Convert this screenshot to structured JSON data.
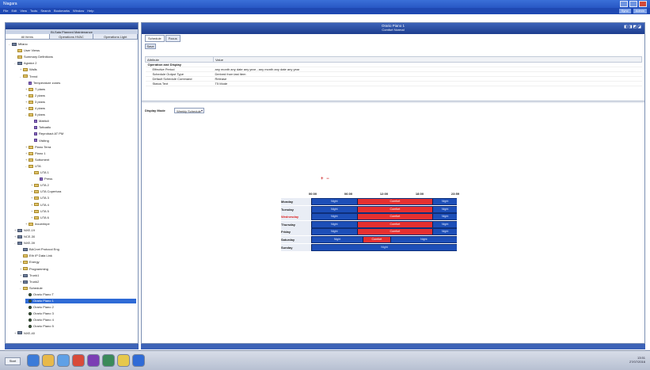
{
  "window": {
    "title": "Niagara",
    "menu": [
      "File",
      "Edit",
      "View",
      "Tools",
      "Search",
      "Bookmarks",
      "Window",
      "Help"
    ],
    "right_buttons": [
      "Sync",
      "Admin"
    ]
  },
  "left_pane": {
    "header": "Bi-Sala Planned Maintenance",
    "tabs": [
      "All Items",
      "Operations HVAC",
      "Operations Light"
    ],
    "tree": [
      {
        "label": "Milano",
        "depth": 0,
        "icon": "station-icon",
        "exp": "-"
      },
      {
        "label": "User Views",
        "depth": 1,
        "icon": "folder-icon",
        "exp": ""
      },
      {
        "label": "Summary Definitions",
        "depth": 1,
        "icon": "folder-icon",
        "exp": ""
      },
      {
        "label": "Agrator 2",
        "depth": 1,
        "icon": "controller-icon",
        "exp": "-"
      },
      {
        "label": "Walls",
        "depth": 2,
        "icon": "folder-icon",
        "exp": "+"
      },
      {
        "label": "Trend",
        "depth": 2,
        "icon": "folder-icon",
        "exp": "-"
      },
      {
        "label": "Temperature zones",
        "depth": 3,
        "icon": "point-icon",
        "exp": ""
      },
      {
        "label": "T plans",
        "depth": 3,
        "icon": "folder-icon",
        "exp": "+"
      },
      {
        "label": "2 plans",
        "depth": 3,
        "icon": "folder-icon",
        "exp": "+"
      },
      {
        "label": "3 plans",
        "depth": 3,
        "icon": "folder-icon",
        "exp": "+"
      },
      {
        "label": "4 plans",
        "depth": 3,
        "icon": "folder-icon",
        "exp": "+"
      },
      {
        "label": "5 plans",
        "depth": 3,
        "icon": "folder-icon",
        "exp": "-"
      },
      {
        "label": "Mattioli",
        "depth": 4,
        "icon": "point-icon",
        "exp": ""
      },
      {
        "label": "Tottoatlo",
        "depth": 4,
        "icon": "point-icon",
        "exp": ""
      },
      {
        "label": "Reprobact AT PM",
        "depth": 4,
        "icon": "point-icon",
        "exp": ""
      },
      {
        "label": "Visiting",
        "depth": 4,
        "icon": "point-icon",
        "exp": ""
      },
      {
        "label": "Piano Terra",
        "depth": 3,
        "icon": "folder-icon",
        "exp": "+"
      },
      {
        "label": "Piano 1",
        "depth": 3,
        "icon": "folder-icon",
        "exp": "+"
      },
      {
        "label": "Sottoment",
        "depth": 3,
        "icon": "folder-icon",
        "exp": "+"
      },
      {
        "label": "UTA",
        "depth": 3,
        "icon": "folder-icon",
        "exp": "-"
      },
      {
        "label": "UTA 1",
        "depth": 4,
        "icon": "folder-icon",
        "exp": "-"
      },
      {
        "label": "Press",
        "depth": 5,
        "icon": "point-icon",
        "exp": ""
      },
      {
        "label": "UTA 2",
        "depth": 4,
        "icon": "folder-icon",
        "exp": "+"
      },
      {
        "label": "UTA Copertura",
        "depth": 4,
        "icon": "folder-icon",
        "exp": "+"
      },
      {
        "label": "UTA 3",
        "depth": 4,
        "icon": "folder-icon",
        "exp": "+"
      },
      {
        "label": "UTA 4",
        "depth": 4,
        "icon": "folder-icon",
        "exp": "+"
      },
      {
        "label": "UTA 5",
        "depth": 4,
        "icon": "folder-icon",
        "exp": "+"
      },
      {
        "label": "UTA 6",
        "depth": 4,
        "icon": "folder-icon",
        "exp": "+"
      },
      {
        "label": "Incubrinpe",
        "depth": 3,
        "icon": "folder-icon",
        "exp": "+"
      },
      {
        "label": "NXE-19",
        "depth": 1,
        "icon": "network-icon",
        "exp": "+"
      },
      {
        "label": "NCE-30",
        "depth": 1,
        "icon": "network-icon",
        "exp": "+"
      },
      {
        "label": "NXE-39",
        "depth": 1,
        "icon": "network-icon",
        "exp": "-"
      },
      {
        "label": "BACnet Protocol Eng",
        "depth": 2,
        "icon": "network-icon",
        "exp": ""
      },
      {
        "label": "Eth IP Data Link",
        "depth": 2,
        "icon": "folder-icon",
        "exp": ""
      },
      {
        "label": "Energy",
        "depth": 2,
        "icon": "folder-icon",
        "exp": "+"
      },
      {
        "label": "Programming",
        "depth": 2,
        "icon": "folder-icon",
        "exp": "+"
      },
      {
        "label": "Trunk1",
        "depth": 2,
        "icon": "network-icon",
        "exp": "+"
      },
      {
        "label": "Trunk2",
        "depth": 2,
        "icon": "network-icon",
        "exp": "+"
      },
      {
        "label": "Schedule",
        "depth": 2,
        "icon": "folder-icon",
        "exp": "-"
      },
      {
        "label": "Orario Piano T",
        "depth": 3,
        "icon": "schedule-icon",
        "exp": ""
      },
      {
        "label": "Orario Piano 1",
        "depth": 3,
        "icon": "schedule-icon",
        "exp": "",
        "selected": true
      },
      {
        "label": "Orario Piano 2",
        "depth": 3,
        "icon": "schedule-icon",
        "exp": ""
      },
      {
        "label": "Orario Piano 3",
        "depth": 3,
        "icon": "schedule-icon",
        "exp": ""
      },
      {
        "label": "Orario Piano 4",
        "depth": 3,
        "icon": "schedule-icon",
        "exp": ""
      },
      {
        "label": "Orario Piano 5",
        "depth": 3,
        "icon": "schedule-icon",
        "exp": ""
      },
      {
        "label": "NXE-40",
        "depth": 1,
        "icon": "network-icon",
        "exp": "+"
      }
    ]
  },
  "right_pane": {
    "title": "Orario Piano 1",
    "subtitle": "Comfort   Normal",
    "tabs": [
      "Schedule",
      "Focus"
    ],
    "save_label": "Save",
    "table_headers": [
      "Attribute",
      "Value"
    ],
    "table_rows": [
      {
        "attr": "Operation and Display",
        "value": "",
        "group": true
      },
      {
        "attr": "Effective Period",
        "value": "any month any date any year - any month any date any year",
        "group": false
      },
      {
        "attr": "Schedule Output Type",
        "value": "Derived from last item",
        "group": false
      },
      {
        "attr": "Default Schedule Command",
        "value": "Release",
        "group": false
      },
      {
        "attr": "Status Text",
        "value": "T5 Mode",
        "group": false
      }
    ],
    "display_mode_label": "Display Mode",
    "display_mode_value": "Weekly Schedule"
  },
  "schedule": {
    "zoom_controls": "+ −",
    "ticks": [
      "00:00",
      "06:00",
      "12:00",
      "18:00",
      "23:59"
    ],
    "days": [
      {
        "name": "Monday",
        "today": false,
        "segments": [
          {
            "start": 0,
            "end": 7.5,
            "state": "Night"
          },
          {
            "start": 7.5,
            "end": 20,
            "state": "Comfort"
          },
          {
            "start": 20,
            "end": 24,
            "state": "Night"
          }
        ]
      },
      {
        "name": "Tuesday",
        "today": false,
        "segments": [
          {
            "start": 0,
            "end": 7.5,
            "state": "Night"
          },
          {
            "start": 7.5,
            "end": 20,
            "state": "Comfort"
          },
          {
            "start": 20,
            "end": 24,
            "state": "Night"
          }
        ]
      },
      {
        "name": "Wednesday",
        "today": true,
        "segments": [
          {
            "start": 0,
            "end": 7.5,
            "state": "Night"
          },
          {
            "start": 7.5,
            "end": 20,
            "state": "Comfort"
          },
          {
            "start": 20,
            "end": 24,
            "state": "Night"
          }
        ]
      },
      {
        "name": "Thursday",
        "today": false,
        "segments": [
          {
            "start": 0,
            "end": 7.5,
            "state": "Night"
          },
          {
            "start": 7.5,
            "end": 20,
            "state": "Comfort"
          },
          {
            "start": 20,
            "end": 24,
            "state": "Night"
          }
        ]
      },
      {
        "name": "Friday",
        "today": false,
        "segments": [
          {
            "start": 0,
            "end": 7.5,
            "state": "Night"
          },
          {
            "start": 7.5,
            "end": 20,
            "state": "Comfort"
          },
          {
            "start": 20,
            "end": 24,
            "state": "Night"
          }
        ]
      },
      {
        "name": "Saturday",
        "today": false,
        "segments": [
          {
            "start": 0,
            "end": 8.5,
            "state": "Night"
          },
          {
            "start": 8.5,
            "end": 13,
            "state": "Comfort"
          },
          {
            "start": 13,
            "end": 24,
            "state": "Night"
          }
        ]
      },
      {
        "name": "Sunday",
        "today": false,
        "segments": [
          {
            "start": 0,
            "end": 24,
            "state": "Night"
          }
        ]
      }
    ]
  },
  "taskbar": {
    "start_label": "Start",
    "tray_time": "13:51",
    "tray_date": "27/07/2016",
    "icons": [
      "ie-icon",
      "folder-icon",
      "media-icon",
      "chrome-icon",
      "onenote-icon",
      "calc-icon",
      "paint-icon",
      "niagara-icon"
    ]
  },
  "colors": {
    "night": "#1d4fb8",
    "comfort": "#e53030",
    "header": "#1d3d8e",
    "selection": "#2f6bd6"
  }
}
